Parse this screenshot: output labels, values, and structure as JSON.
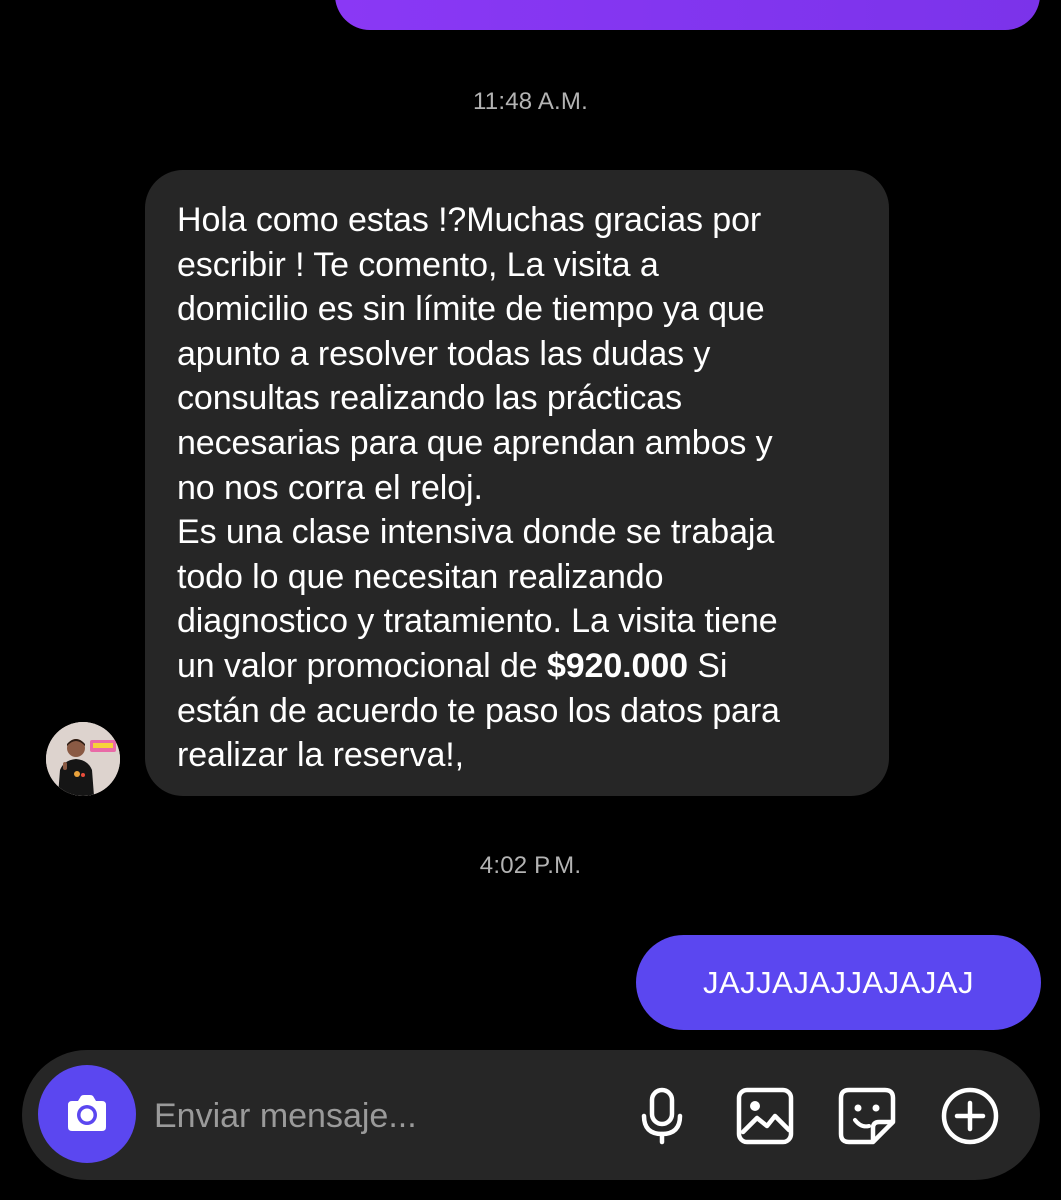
{
  "thread": {
    "timestamps": [
      "11:48 A.M.",
      "4:02 P.M."
    ],
    "incoming_message": {
      "text_before": "Hola como estas !?Muchas gracias por\nescribir ! Te comento, La visita a\ndomicilio es sin límite de tiempo ya que\napunto a resolver todas las dudas y\nconsultas realizando las prácticas\nnecesarias para que aprendan ambos y\nno nos corra el reloj.\nEs una clase intensiva donde se trabaja\ntodo lo que necesitan realizando\ndiagnostico y tratamiento. La visita tiene\nun valor promocional de ",
      "price": "$920.000",
      "text_after": "  Si\nestán de acuerdo te paso los datos para\nrealizar la reserva!,"
    },
    "outgoing_message": {
      "text": "JAJJAJAJJAJAJAJ"
    }
  },
  "composer": {
    "placeholder": "Enviar mensaje...",
    "value": "",
    "icons": [
      "camera-icon",
      "microphone-icon",
      "gallery-icon",
      "sticker-icon",
      "plus-icon"
    ]
  },
  "colors": {
    "background": "#000000",
    "incoming_bubble": "#262626",
    "outgoing_bubble": "#5b47f0",
    "previous_bubble": "#8a38f5",
    "timestamp": "#b3b3b3",
    "composer": "#262626",
    "accent": "#5b47f0"
  }
}
